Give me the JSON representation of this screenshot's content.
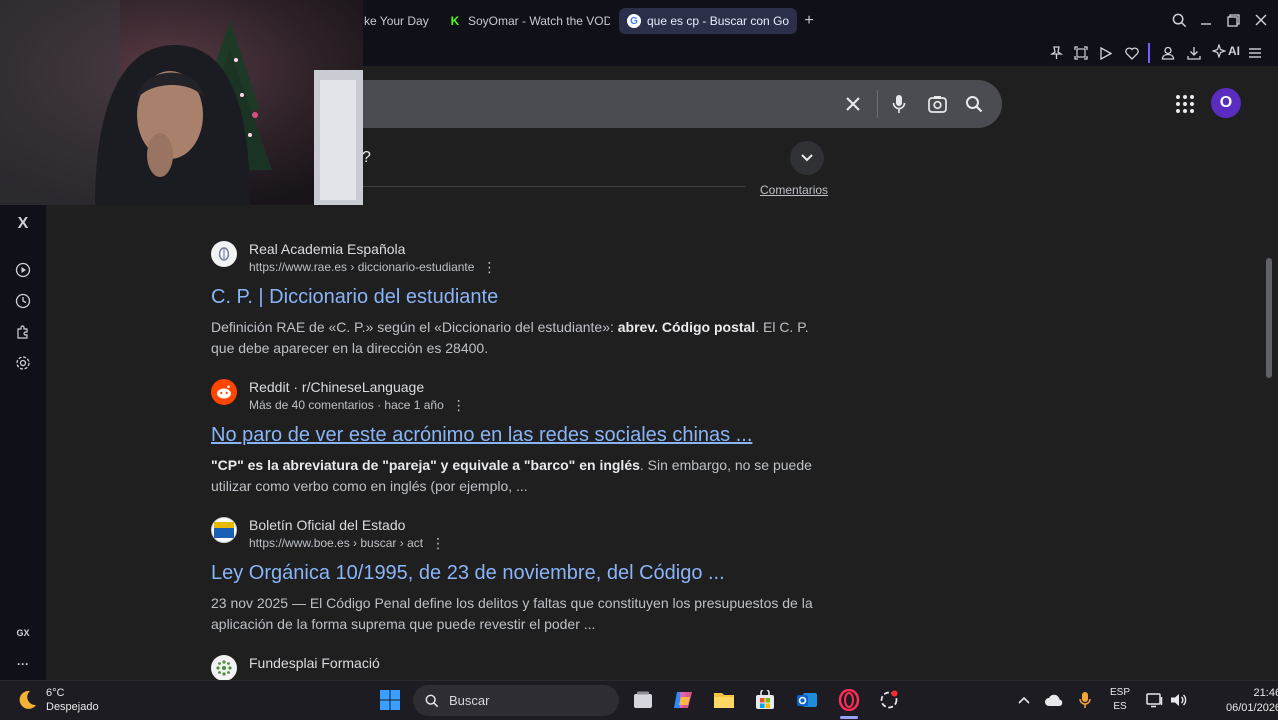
{
  "browser": {
    "tabs": [
      {
        "label": "ke Your Day",
        "favicon": ""
      },
      {
        "label": "SoyOmar - Watch the VOD",
        "favicon": "K"
      },
      {
        "label": "que es cp - Buscar con Go",
        "favicon": "G"
      }
    ],
    "new_tab": "+",
    "ai_label": "AI"
  },
  "sidebar": {
    "x_label": "X",
    "gx_label": "GX",
    "more_label": "···"
  },
  "search": {
    "query_fragment": "?",
    "feedback_label": "Comentarios",
    "avatar_letter": "O"
  },
  "results": [
    {
      "site": "Real Academia Española",
      "url": "https://www.rae.es › diccionario-estudiante",
      "title": "C. P. | Diccionario del estudiante",
      "snippet_pre": "Definición RAE de «C. P.» según el «Diccionario del estudiante»: ",
      "snippet_bold": "abrev. Código postal",
      "snippet_post": ". El C. P. que debe aparecer en la dirección es 28400."
    },
    {
      "site": "Reddit · r/ChineseLanguage",
      "url": "Más de 40 comentarios · hace 1 año",
      "title": "No paro de ver este acrónimo en las redes sociales chinas ...",
      "snippet_pre": "",
      "snippet_bold": "\"CP\" es la abreviatura de \"pareja\" y equivale a \"barco\" en inglés",
      "snippet_post": ". Sin embargo, no se puede utilizar como verbo como en inglés (por ejemplo, ..."
    },
    {
      "site": "Boletín Oficial del Estado",
      "url": "https://www.boe.es › buscar › act",
      "title": "Ley Orgánica 10/1995, de 23 de noviembre, del Código ...",
      "snippet_pre": "23 nov 2025 — El Código Penal define los delitos y faltas que constituyen los presupuestos de la aplicación de la forma suprema que puede revestir el poder ...",
      "snippet_bold": "",
      "snippet_post": ""
    },
    {
      "site": "Fundesplai Formació",
      "url": "",
      "title": "",
      "snippet_pre": "",
      "snippet_bold": "",
      "snippet_post": ""
    }
  ],
  "taskbar": {
    "temperature": "6°C",
    "condition": "Despejado",
    "search_placeholder": "Buscar",
    "lang_line1": "ESP",
    "lang_line2": "ES",
    "time": "21:46",
    "date": "06/01/2026"
  }
}
